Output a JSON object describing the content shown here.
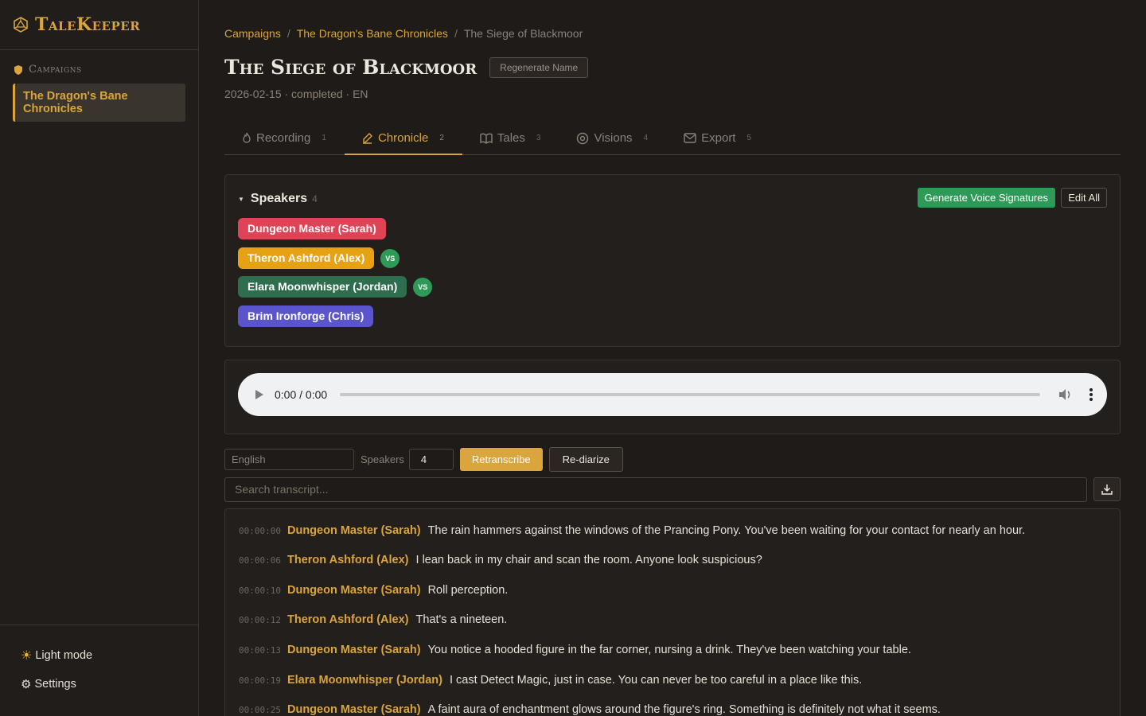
{
  "app": {
    "name": "TaleKeeper"
  },
  "sidebar": {
    "section_label": "Campaigns",
    "items": [
      {
        "label": "The Dragon's Bane Chronicles"
      }
    ],
    "light_mode_label": "Light mode",
    "settings_label": "Settings"
  },
  "breadcrumb": [
    "Campaigns",
    "The Dragon's Bane Chronicles",
    "The Siege of Blackmoor"
  ],
  "breadcrumb_sep": "/",
  "session": {
    "title": "The Siege of Blackmoor",
    "regenerate_label": "Regenerate Name",
    "meta": "2026-02-15 · completed · EN"
  },
  "tabs": [
    {
      "label": "Recording",
      "num": "1",
      "icon": "flame-icon"
    },
    {
      "label": "Chronicle",
      "num": "2",
      "icon": "quill-icon",
      "active": true
    },
    {
      "label": "Tales",
      "num": "3",
      "icon": "book-icon"
    },
    {
      "label": "Visions",
      "num": "4",
      "icon": "eye-icon"
    },
    {
      "label": "Export",
      "num": "5",
      "icon": "mail-icon"
    }
  ],
  "speakers": {
    "title": "Speakers",
    "count": "4",
    "generate_label": "Generate Voice Signatures",
    "edit_label": "Edit All",
    "badge": "VS",
    "list": [
      {
        "name": "Dungeon Master (Sarah)",
        "color": "#e04256",
        "vs": false
      },
      {
        "name": "Theron Ashford (Alex)",
        "color": "#e6a213",
        "vs": true
      },
      {
        "name": "Elara Moonwhisper (Jordan)",
        "color": "#2e6e4e",
        "vs": true
      },
      {
        "name": "Brim Ironforge (Chris)",
        "color": "#5b55cc",
        "vs": false
      }
    ]
  },
  "audio": {
    "time": "0:00 / 0:00"
  },
  "controls": {
    "language_value": "English",
    "speakers_label": "Speakers",
    "speakers_value": "4",
    "retranscribe_label": "Retranscribe",
    "rediarize_label": "Re-diarize"
  },
  "search": {
    "placeholder": "Search transcript..."
  },
  "transcript": [
    {
      "ts": "00:00:00",
      "speaker": "Dungeon Master (Sarah)",
      "text": "The rain hammers against the windows of the Prancing Pony. You've been waiting for your contact for nearly an hour."
    },
    {
      "ts": "00:00:06",
      "speaker": "Theron Ashford (Alex)",
      "text": "I lean back in my chair and scan the room. Anyone look suspicious?"
    },
    {
      "ts": "00:00:10",
      "speaker": "Dungeon Master (Sarah)",
      "text": "Roll perception."
    },
    {
      "ts": "00:00:12",
      "speaker": "Theron Ashford (Alex)",
      "text": "That's a nineteen."
    },
    {
      "ts": "00:00:13",
      "speaker": "Dungeon Master (Sarah)",
      "text": "You notice a hooded figure in the far corner, nursing a drink. They've been watching your table."
    },
    {
      "ts": "00:00:19",
      "speaker": "Elara Moonwhisper (Jordan)",
      "text": "I cast Detect Magic, just in case. You can never be too careful in a place like this."
    },
    {
      "ts": "00:00:25",
      "speaker": "Dungeon Master (Sarah)",
      "text": "A faint aura of enchantment glows around the figure's ring. Something is definitely not what it seems."
    }
  ]
}
